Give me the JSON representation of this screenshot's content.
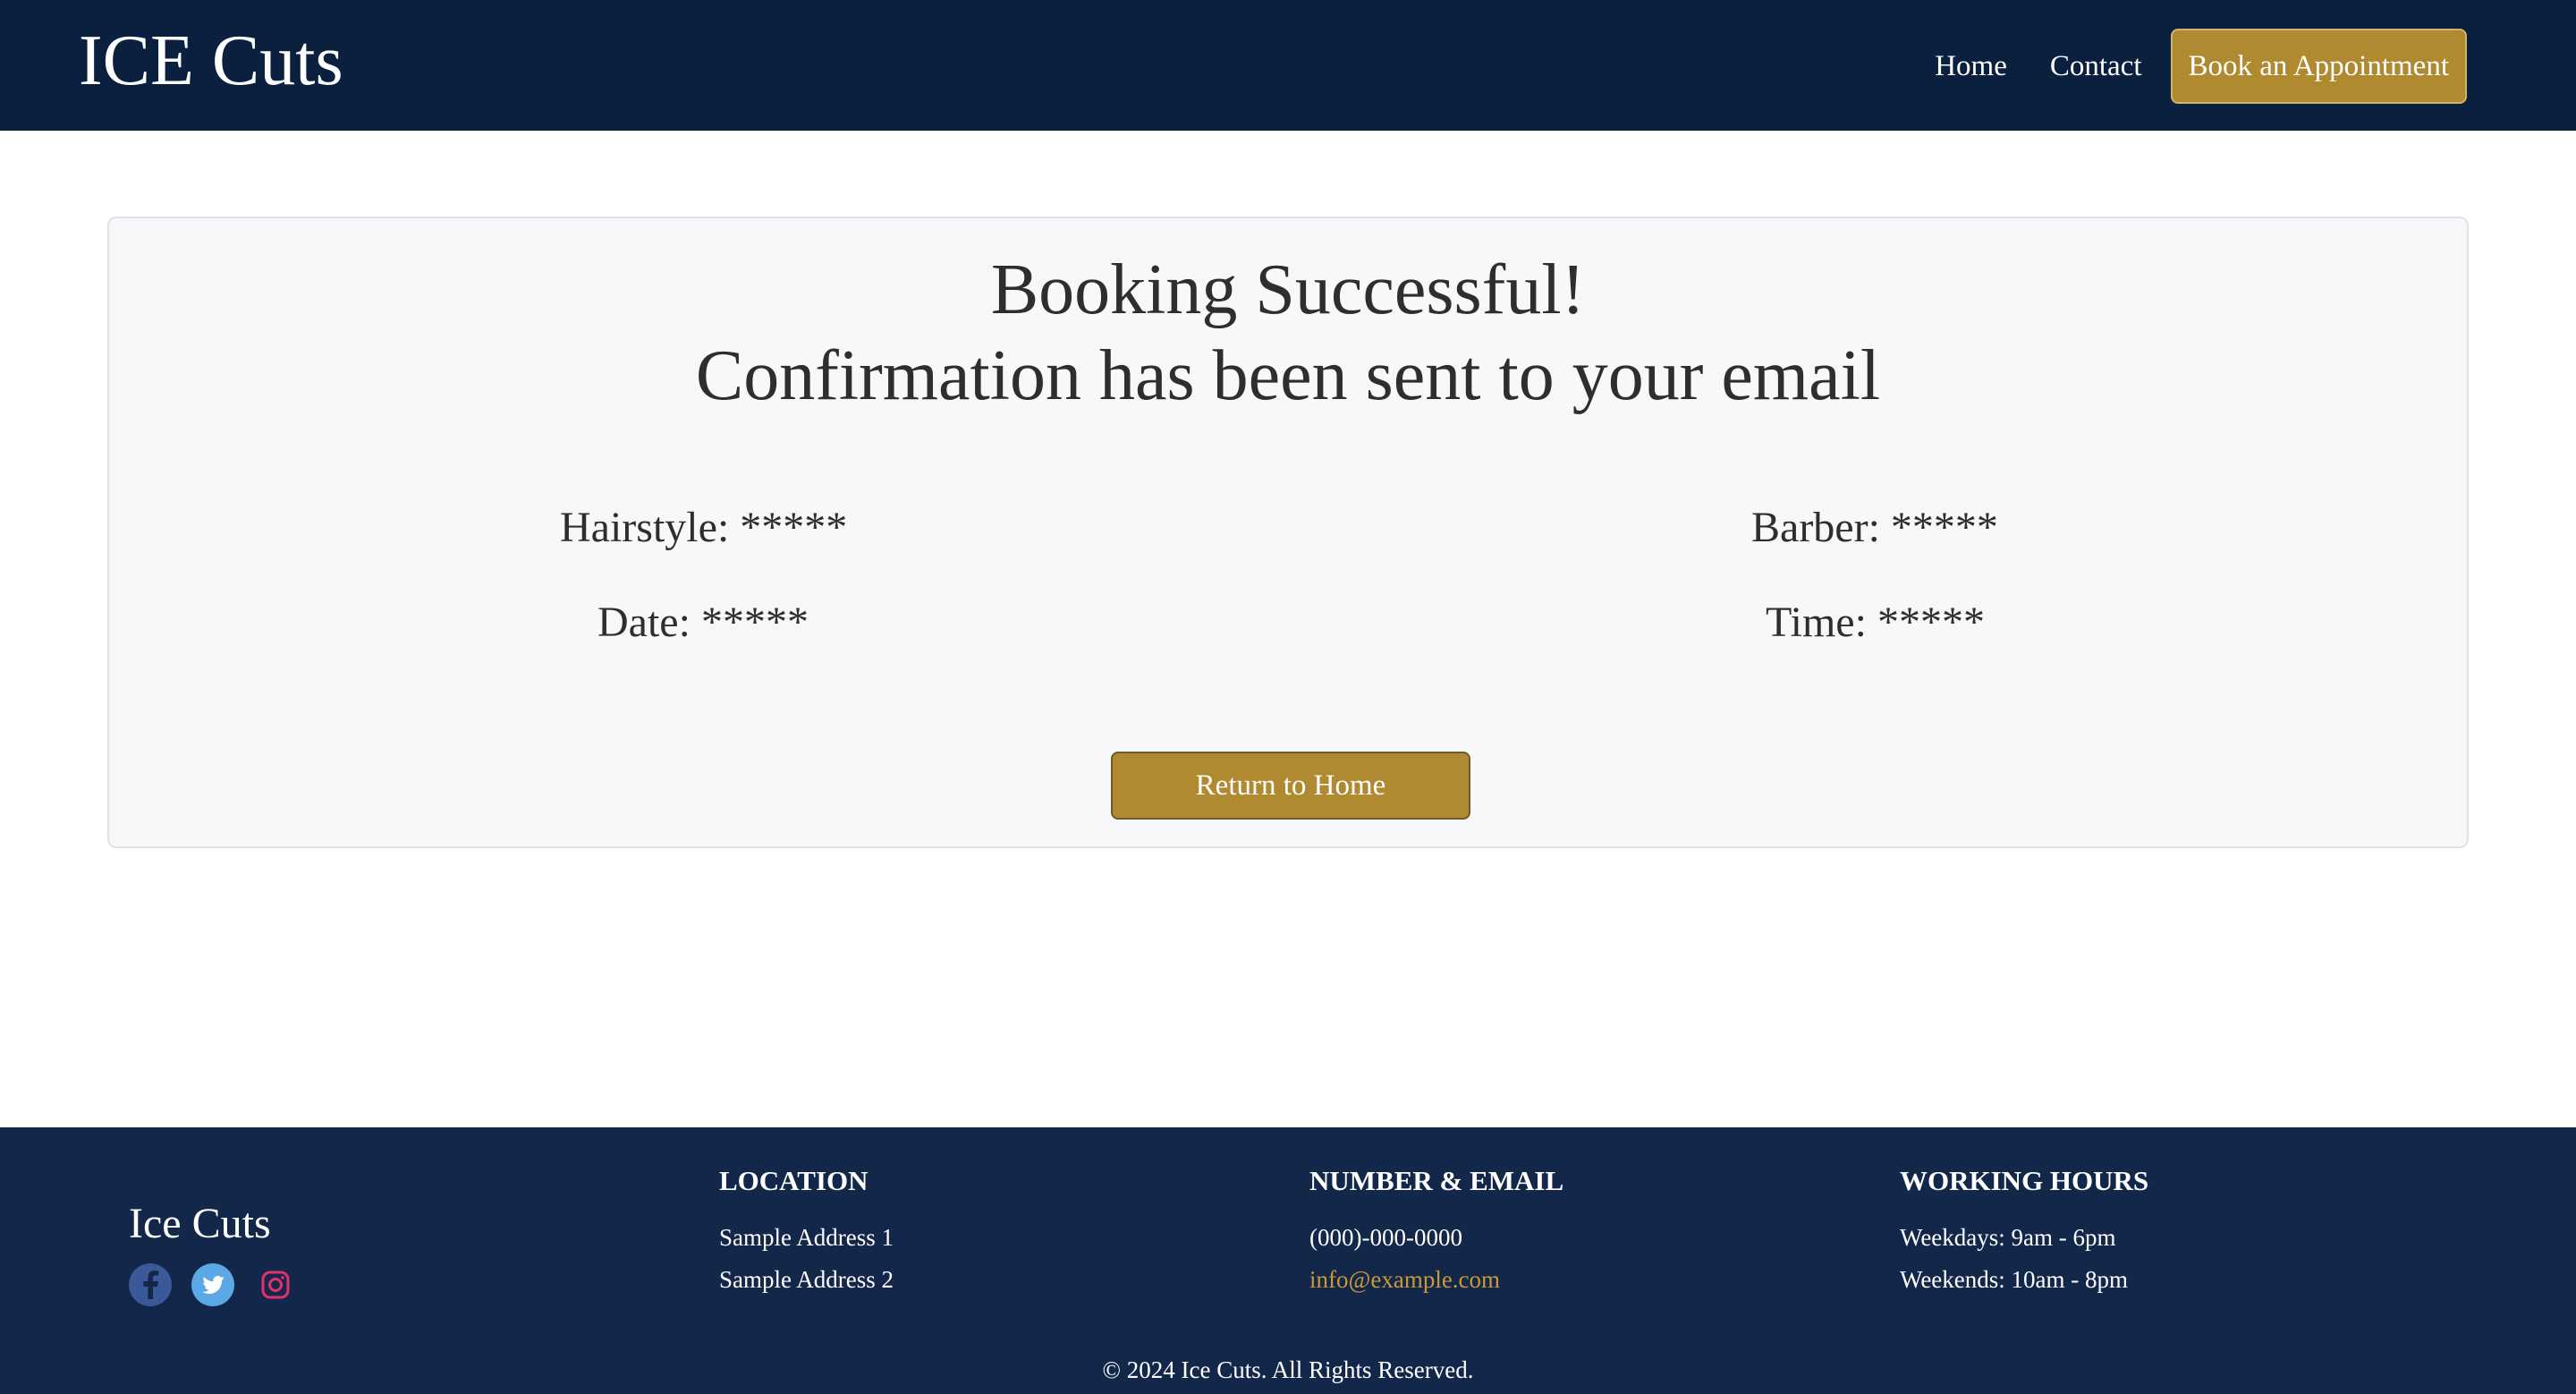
{
  "nav": {
    "brand": "ICE Cuts",
    "home": "Home",
    "contact": "Contact",
    "book": "Book an Appointment"
  },
  "confirmation": {
    "title_line1": "Booking Successful!",
    "title_line2": "Confirmation has been sent to your email",
    "hairstyle": "Hairstyle: *****",
    "barber": "Barber: *****",
    "date": "Date: *****",
    "time": "Time: *****",
    "return_button": "Return to Home"
  },
  "footer": {
    "brand": "Ice Cuts",
    "social_icons": [
      "facebook-icon",
      "twitter-icon",
      "instagram-icon"
    ],
    "location": {
      "heading": "LOCATION",
      "lines": [
        "Sample Address 1",
        "Sample Address 2"
      ]
    },
    "contact": {
      "heading": "NUMBER & EMAIL",
      "phone": "(000)-000-0000",
      "email": "info@example.com"
    },
    "hours": {
      "heading": "WORKING HOURS",
      "lines": [
        "Weekdays: 9am - 6pm",
        "Weekends: 10am - 8pm"
      ]
    },
    "copyright": "© 2024 Ice Cuts. All Rights Reserved."
  },
  "colors": {
    "navbar": "#0b1f3f",
    "footer": "#13274a",
    "accent": "#b08a30",
    "card": "#f7f8fa"
  }
}
